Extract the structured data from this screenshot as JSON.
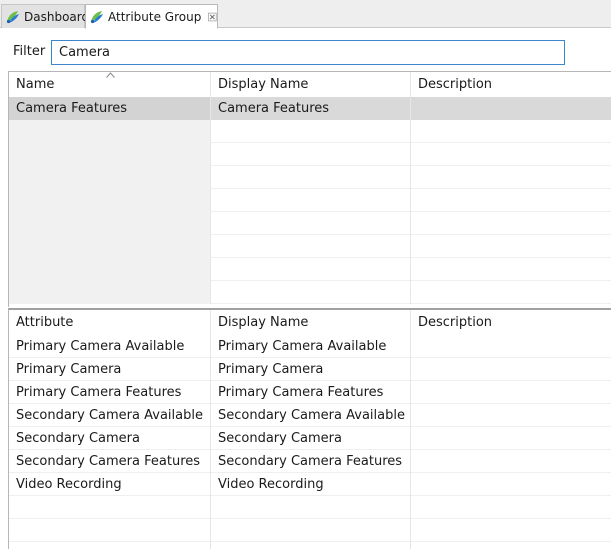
{
  "tabs": [
    {
      "label": "Dashboard",
      "icon": "app-icon",
      "active": false
    },
    {
      "label": "Attribute Group",
      "icon": "app-icon",
      "active": true,
      "close_icon": "close-icon"
    }
  ],
  "filter": {
    "label": "Filter",
    "value": "Camera"
  },
  "groups_table": {
    "columns": [
      "Name",
      "Display Name",
      "Description"
    ],
    "sort": {
      "column": "Name",
      "direction": "ascending"
    },
    "rows": [
      {
        "name": "Camera Features",
        "display_name": "Camera Features",
        "description": "",
        "selected": true
      }
    ]
  },
  "attributes_table": {
    "columns": [
      "Attribute",
      "Display Name",
      "Description"
    ],
    "rows": [
      {
        "attribute": "Primary Camera Available",
        "display_name": "Primary Camera Available",
        "description": ""
      },
      {
        "attribute": "Primary Camera",
        "display_name": "Primary Camera",
        "description": ""
      },
      {
        "attribute": "Primary Camera Features",
        "display_name": "Primary Camera Features",
        "description": ""
      },
      {
        "attribute": "Secondary Camera Available",
        "display_name": "Secondary Camera Available",
        "description": ""
      },
      {
        "attribute": "Secondary Camera",
        "display_name": "Secondary Camera",
        "description": ""
      },
      {
        "attribute": "Secondary Camera Features",
        "display_name": "Secondary Camera Features",
        "description": ""
      },
      {
        "attribute": "Video Recording",
        "display_name": "Video Recording",
        "description": ""
      }
    ]
  },
  "colors": {
    "selection": "#d9d9d9",
    "input_focus_border": "#3c86c9",
    "tab_bar": "#eeeeee",
    "icon_blue": "#2b7bd6",
    "icon_green": "#6cc04a"
  }
}
